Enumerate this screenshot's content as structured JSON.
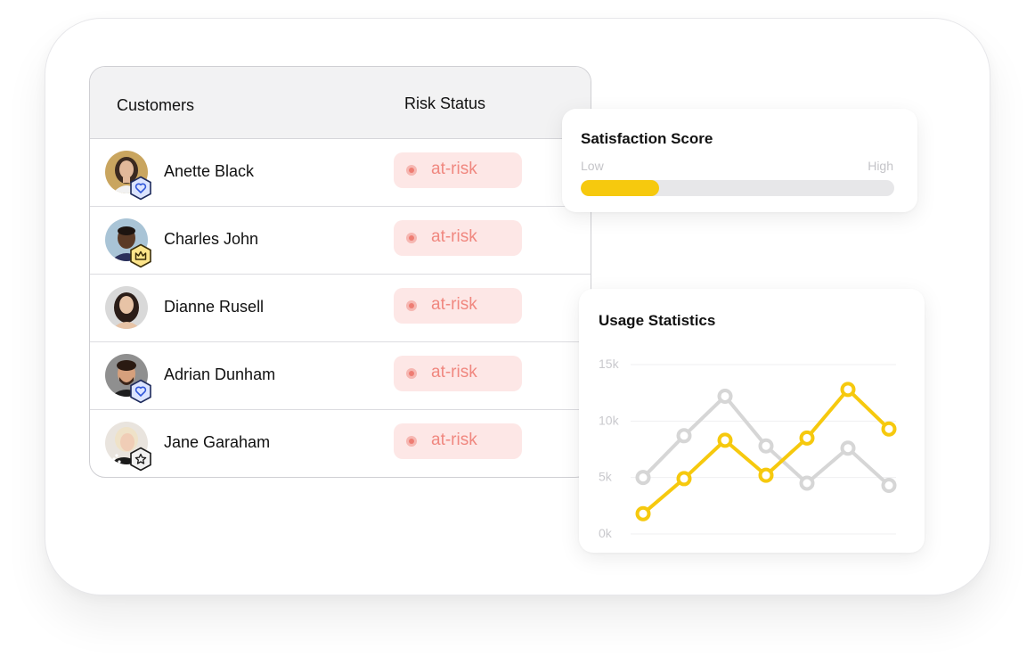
{
  "customers_table": {
    "headers": {
      "customers": "Customers",
      "risk_status": "Risk Status"
    },
    "rows": [
      {
        "name": "Anette Black",
        "status": "at-risk",
        "badge": "heart-badge",
        "avatar_bg": "#c9a55f"
      },
      {
        "name": "Charles John",
        "status": "at-risk",
        "badge": "crown-badge",
        "avatar_bg": "#a9c4d6"
      },
      {
        "name": "Dianne Rusell",
        "status": "at-risk",
        "badge": "",
        "avatar_bg": "#d9d9d9"
      },
      {
        "name": "Adrian Dunham",
        "status": "at-risk",
        "badge": "heart-badge",
        "avatar_bg": "#8f8f8f"
      },
      {
        "name": "Jane Garaham",
        "status": "at-risk",
        "badge": "star-badge",
        "avatar_bg": "#e9e4de"
      }
    ]
  },
  "satisfaction": {
    "title": "Satisfaction Score",
    "low_label": "Low",
    "high_label": "High",
    "level": 0.25,
    "accent": "#f6c90e"
  },
  "usage": {
    "title": "Usage Statistics"
  },
  "chart_data": {
    "type": "line",
    "title": "Usage Statistics",
    "y_ticks": [
      "15k",
      "10k",
      "5k",
      "0k"
    ],
    "ylim": [
      0,
      15000
    ],
    "grid": true,
    "series": [
      {
        "color": "#d6d6d6",
        "values": [
          5000,
          8700,
          12200,
          7800,
          4500,
          7600,
          4300
        ]
      },
      {
        "color": "#f6c90e",
        "values": [
          1800,
          4900,
          8300,
          5200,
          8500,
          12800,
          9300
        ]
      }
    ],
    "series_x": [
      [
        0,
        1,
        2,
        3,
        4,
        5,
        6
      ],
      [
        0,
        1,
        2,
        3,
        4,
        5,
        6
      ]
    ]
  }
}
